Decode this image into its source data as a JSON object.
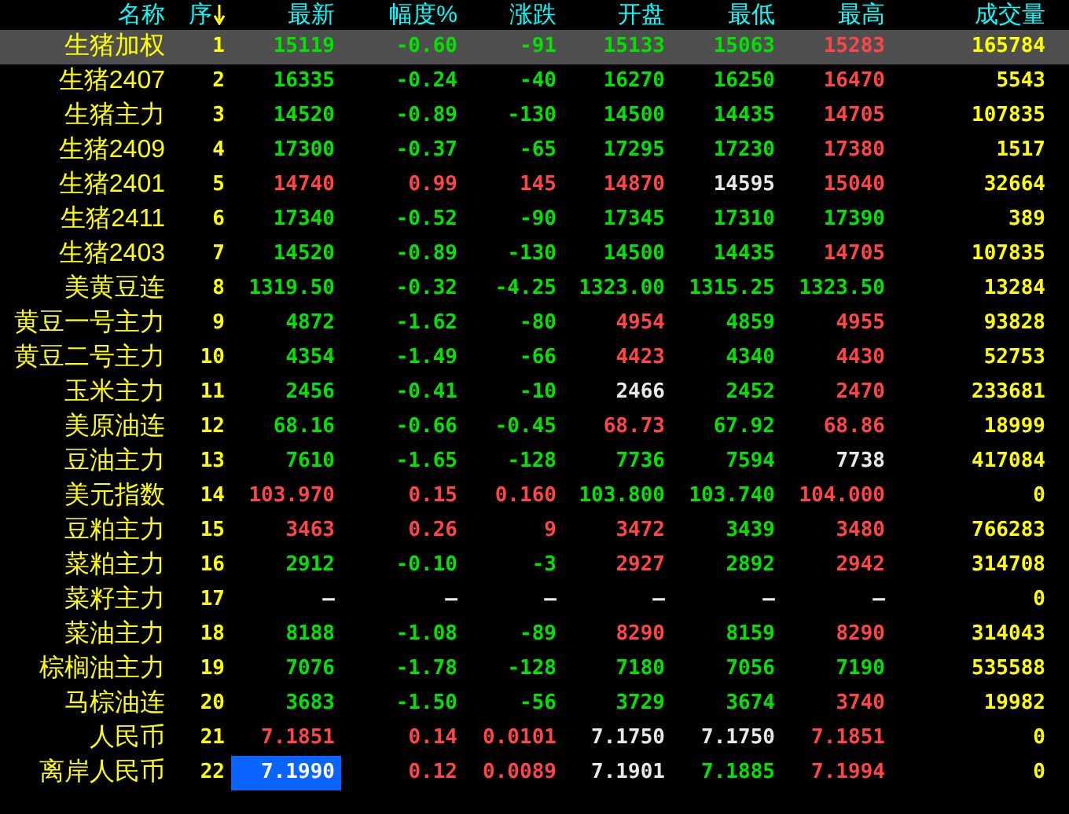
{
  "table": {
    "columns": [
      {
        "label": "名称",
        "sorted": false
      },
      {
        "label": "序",
        "sorted": true
      },
      {
        "label": "最新",
        "sorted": false
      },
      {
        "label": "幅度%",
        "sorted": false
      },
      {
        "label": "涨跌",
        "sorted": false
      },
      {
        "label": "开盘",
        "sorted": false
      },
      {
        "label": "最低",
        "sorted": false
      },
      {
        "label": "最高",
        "sorted": false
      },
      {
        "label": "成交量",
        "sorted": false
      }
    ],
    "rows": [
      {
        "selected": true,
        "focused": false,
        "cells": [
          {
            "text": "生猪加权",
            "color": "#ffff00"
          },
          {
            "text": "1",
            "color": "#ffff00"
          },
          {
            "text": "15119",
            "color": "#00e400"
          },
          {
            "text": "-0.60",
            "color": "#00e400"
          },
          {
            "text": "-91",
            "color": "#00e400"
          },
          {
            "text": "15133",
            "color": "#00e400"
          },
          {
            "text": "15063",
            "color": "#00e400"
          },
          {
            "text": "15283",
            "color": "#ff4545"
          },
          {
            "text": "165784",
            "color": "#ffff00"
          }
        ]
      },
      {
        "selected": false,
        "focused": false,
        "cells": [
          {
            "text": "生猪2407",
            "color": "#ffff00"
          },
          {
            "text": "2",
            "color": "#ffff00"
          },
          {
            "text": "16335",
            "color": "#00e400"
          },
          {
            "text": "-0.24",
            "color": "#00e400"
          },
          {
            "text": "-40",
            "color": "#00e400"
          },
          {
            "text": "16270",
            "color": "#00e400"
          },
          {
            "text": "16250",
            "color": "#00e400"
          },
          {
            "text": "16470",
            "color": "#ff4545"
          },
          {
            "text": "5543",
            "color": "#ffff00"
          }
        ]
      },
      {
        "selected": false,
        "focused": false,
        "cells": [
          {
            "text": "生猪主力",
            "color": "#ffff00"
          },
          {
            "text": "3",
            "color": "#ffff00"
          },
          {
            "text": "14520",
            "color": "#00e400"
          },
          {
            "text": "-0.89",
            "color": "#00e400"
          },
          {
            "text": "-130",
            "color": "#00e400"
          },
          {
            "text": "14500",
            "color": "#00e400"
          },
          {
            "text": "14435",
            "color": "#00e400"
          },
          {
            "text": "14705",
            "color": "#ff4545"
          },
          {
            "text": "107835",
            "color": "#ffff00"
          }
        ]
      },
      {
        "selected": false,
        "focused": false,
        "cells": [
          {
            "text": "生猪2409",
            "color": "#ffff00"
          },
          {
            "text": "4",
            "color": "#ffff00"
          },
          {
            "text": "17300",
            "color": "#00e400"
          },
          {
            "text": "-0.37",
            "color": "#00e400"
          },
          {
            "text": "-65",
            "color": "#00e400"
          },
          {
            "text": "17295",
            "color": "#00e400"
          },
          {
            "text": "17230",
            "color": "#00e400"
          },
          {
            "text": "17380",
            "color": "#ff4545"
          },
          {
            "text": "1517",
            "color": "#ffff00"
          }
        ]
      },
      {
        "selected": false,
        "focused": false,
        "cells": [
          {
            "text": "生猪2401",
            "color": "#ffff00"
          },
          {
            "text": "5",
            "color": "#ffff00"
          },
          {
            "text": "14740",
            "color": "#ff4545"
          },
          {
            "text": "0.99",
            "color": "#ff4545"
          },
          {
            "text": "145",
            "color": "#ff4545"
          },
          {
            "text": "14870",
            "color": "#ff4545"
          },
          {
            "text": "14595",
            "color": "#e8e8e8"
          },
          {
            "text": "15040",
            "color": "#ff4545"
          },
          {
            "text": "32664",
            "color": "#ffff00"
          }
        ]
      },
      {
        "selected": false,
        "focused": false,
        "cells": [
          {
            "text": "生猪2411",
            "color": "#ffff00"
          },
          {
            "text": "6",
            "color": "#ffff00"
          },
          {
            "text": "17340",
            "color": "#00e400"
          },
          {
            "text": "-0.52",
            "color": "#00e400"
          },
          {
            "text": "-90",
            "color": "#00e400"
          },
          {
            "text": "17345",
            "color": "#00e400"
          },
          {
            "text": "17310",
            "color": "#00e400"
          },
          {
            "text": "17390",
            "color": "#00e400"
          },
          {
            "text": "389",
            "color": "#ffff00"
          }
        ]
      },
      {
        "selected": false,
        "focused": false,
        "cells": [
          {
            "text": "生猪2403",
            "color": "#ffff00"
          },
          {
            "text": "7",
            "color": "#ffff00"
          },
          {
            "text": "14520",
            "color": "#00e400"
          },
          {
            "text": "-0.89",
            "color": "#00e400"
          },
          {
            "text": "-130",
            "color": "#00e400"
          },
          {
            "text": "14500",
            "color": "#00e400"
          },
          {
            "text": "14435",
            "color": "#00e400"
          },
          {
            "text": "14705",
            "color": "#ff4545"
          },
          {
            "text": "107835",
            "color": "#ffff00"
          }
        ]
      },
      {
        "selected": false,
        "focused": false,
        "cells": [
          {
            "text": "美黄豆连",
            "color": "#ffff00"
          },
          {
            "text": "8",
            "color": "#ffff00"
          },
          {
            "text": "1319.50",
            "color": "#00e400"
          },
          {
            "text": "-0.32",
            "color": "#00e400"
          },
          {
            "text": "-4.25",
            "color": "#00e400"
          },
          {
            "text": "1323.00",
            "color": "#00e400"
          },
          {
            "text": "1315.25",
            "color": "#00e400"
          },
          {
            "text": "1323.50",
            "color": "#00e400"
          },
          {
            "text": "13284",
            "color": "#ffff00"
          }
        ]
      },
      {
        "selected": false,
        "focused": false,
        "cells": [
          {
            "text": "黄豆一号主力",
            "color": "#ffff00"
          },
          {
            "text": "9",
            "color": "#ffff00"
          },
          {
            "text": "4872",
            "color": "#00e400"
          },
          {
            "text": "-1.62",
            "color": "#00e400"
          },
          {
            "text": "-80",
            "color": "#00e400"
          },
          {
            "text": "4954",
            "color": "#ff4545"
          },
          {
            "text": "4859",
            "color": "#00e400"
          },
          {
            "text": "4955",
            "color": "#ff4545"
          },
          {
            "text": "93828",
            "color": "#ffff00"
          }
        ]
      },
      {
        "selected": false,
        "focused": false,
        "cells": [
          {
            "text": "黄豆二号主力",
            "color": "#ffff00"
          },
          {
            "text": "10",
            "color": "#ffff00"
          },
          {
            "text": "4354",
            "color": "#00e400"
          },
          {
            "text": "-1.49",
            "color": "#00e400"
          },
          {
            "text": "-66",
            "color": "#00e400"
          },
          {
            "text": "4423",
            "color": "#ff4545"
          },
          {
            "text": "4340",
            "color": "#00e400"
          },
          {
            "text": "4430",
            "color": "#ff4545"
          },
          {
            "text": "52753",
            "color": "#ffff00"
          }
        ]
      },
      {
        "selected": false,
        "focused": false,
        "cells": [
          {
            "text": "玉米主力",
            "color": "#ffff00"
          },
          {
            "text": "11",
            "color": "#ffff00"
          },
          {
            "text": "2456",
            "color": "#00e400"
          },
          {
            "text": "-0.41",
            "color": "#00e400"
          },
          {
            "text": "-10",
            "color": "#00e400"
          },
          {
            "text": "2466",
            "color": "#e8e8e8"
          },
          {
            "text": "2452",
            "color": "#00e400"
          },
          {
            "text": "2470",
            "color": "#ff4545"
          },
          {
            "text": "233681",
            "color": "#ffff00"
          }
        ]
      },
      {
        "selected": false,
        "focused": false,
        "cells": [
          {
            "text": "美原油连",
            "color": "#ffff00"
          },
          {
            "text": "12",
            "color": "#ffff00"
          },
          {
            "text": "68.16",
            "color": "#00e400"
          },
          {
            "text": "-0.66",
            "color": "#00e400"
          },
          {
            "text": "-0.45",
            "color": "#00e400"
          },
          {
            "text": "68.73",
            "color": "#ff4545"
          },
          {
            "text": "67.92",
            "color": "#00e400"
          },
          {
            "text": "68.86",
            "color": "#ff4545"
          },
          {
            "text": "18999",
            "color": "#ffff00"
          }
        ]
      },
      {
        "selected": false,
        "focused": false,
        "cells": [
          {
            "text": "豆油主力",
            "color": "#ffff00"
          },
          {
            "text": "13",
            "color": "#ffff00"
          },
          {
            "text": "7610",
            "color": "#00e400"
          },
          {
            "text": "-1.65",
            "color": "#00e400"
          },
          {
            "text": "-128",
            "color": "#00e400"
          },
          {
            "text": "7736",
            "color": "#00e400"
          },
          {
            "text": "7594",
            "color": "#00e400"
          },
          {
            "text": "7738",
            "color": "#e8e8e8"
          },
          {
            "text": "417084",
            "color": "#ffff00"
          }
        ]
      },
      {
        "selected": false,
        "focused": false,
        "cells": [
          {
            "text": "美元指数",
            "color": "#ffff00"
          },
          {
            "text": "14",
            "color": "#ffff00"
          },
          {
            "text": "103.970",
            "color": "#ff4545"
          },
          {
            "text": "0.15",
            "color": "#ff4545"
          },
          {
            "text": "0.160",
            "color": "#ff4545"
          },
          {
            "text": "103.800",
            "color": "#00e400"
          },
          {
            "text": "103.740",
            "color": "#00e400"
          },
          {
            "text": "104.000",
            "color": "#ff4545"
          },
          {
            "text": "0",
            "color": "#ffff00"
          }
        ]
      },
      {
        "selected": false,
        "focused": false,
        "cells": [
          {
            "text": "豆粕主力",
            "color": "#ffff00"
          },
          {
            "text": "15",
            "color": "#ffff00"
          },
          {
            "text": "3463",
            "color": "#ff4545"
          },
          {
            "text": "0.26",
            "color": "#ff4545"
          },
          {
            "text": "9",
            "color": "#ff4545"
          },
          {
            "text": "3472",
            "color": "#ff4545"
          },
          {
            "text": "3439",
            "color": "#00e400"
          },
          {
            "text": "3480",
            "color": "#ff4545"
          },
          {
            "text": "766283",
            "color": "#ffff00"
          }
        ]
      },
      {
        "selected": false,
        "focused": false,
        "cells": [
          {
            "text": "菜粕主力",
            "color": "#ffff00"
          },
          {
            "text": "16",
            "color": "#ffff00"
          },
          {
            "text": "2912",
            "color": "#00e400"
          },
          {
            "text": "-0.10",
            "color": "#00e400"
          },
          {
            "text": "-3",
            "color": "#00e400"
          },
          {
            "text": "2927",
            "color": "#ff4545"
          },
          {
            "text": "2892",
            "color": "#00e400"
          },
          {
            "text": "2942",
            "color": "#ff4545"
          },
          {
            "text": "314708",
            "color": "#ffff00"
          }
        ]
      },
      {
        "selected": false,
        "focused": false,
        "cells": [
          {
            "text": "菜籽主力",
            "color": "#ffff00"
          },
          {
            "text": "17",
            "color": "#ffff00"
          },
          {
            "text": "—",
            "color": "#e8e8e8"
          },
          {
            "text": "—",
            "color": "#e8e8e8"
          },
          {
            "text": "—",
            "color": "#e8e8e8"
          },
          {
            "text": "—",
            "color": "#e8e8e8"
          },
          {
            "text": "—",
            "color": "#e8e8e8"
          },
          {
            "text": "—",
            "color": "#e8e8e8"
          },
          {
            "text": "0",
            "color": "#ffff00"
          }
        ]
      },
      {
        "selected": false,
        "focused": false,
        "cells": [
          {
            "text": "菜油主力",
            "color": "#ffff00"
          },
          {
            "text": "18",
            "color": "#ffff00"
          },
          {
            "text": "8188",
            "color": "#00e400"
          },
          {
            "text": "-1.08",
            "color": "#00e400"
          },
          {
            "text": "-89",
            "color": "#00e400"
          },
          {
            "text": "8290",
            "color": "#ff4545"
          },
          {
            "text": "8159",
            "color": "#00e400"
          },
          {
            "text": "8290",
            "color": "#ff4545"
          },
          {
            "text": "314043",
            "color": "#ffff00"
          }
        ]
      },
      {
        "selected": false,
        "focused": false,
        "cells": [
          {
            "text": "棕榈油主力",
            "color": "#ffff00"
          },
          {
            "text": "19",
            "color": "#ffff00"
          },
          {
            "text": "7076",
            "color": "#00e400"
          },
          {
            "text": "-1.78",
            "color": "#00e400"
          },
          {
            "text": "-128",
            "color": "#00e400"
          },
          {
            "text": "7180",
            "color": "#00e400"
          },
          {
            "text": "7056",
            "color": "#00e400"
          },
          {
            "text": "7190",
            "color": "#00e400"
          },
          {
            "text": "535588",
            "color": "#ffff00"
          }
        ]
      },
      {
        "selected": false,
        "focused": false,
        "cells": [
          {
            "text": "马棕油连",
            "color": "#ffff00"
          },
          {
            "text": "20",
            "color": "#ffff00"
          },
          {
            "text": "3683",
            "color": "#00e400"
          },
          {
            "text": "-1.50",
            "color": "#00e400"
          },
          {
            "text": "-56",
            "color": "#00e400"
          },
          {
            "text": "3729",
            "color": "#00e400"
          },
          {
            "text": "3674",
            "color": "#00e400"
          },
          {
            "text": "3740",
            "color": "#ff4545"
          },
          {
            "text": "19982",
            "color": "#ffff00"
          }
        ]
      },
      {
        "selected": false,
        "focused": false,
        "cells": [
          {
            "text": "人民币",
            "color": "#ffff00"
          },
          {
            "text": "21",
            "color": "#ffff00"
          },
          {
            "text": "7.1851",
            "color": "#ff4545"
          },
          {
            "text": "0.14",
            "color": "#ff4545"
          },
          {
            "text": "0.0101",
            "color": "#ff4545"
          },
          {
            "text": "7.1750",
            "color": "#e8e8e8"
          },
          {
            "text": "7.1750",
            "color": "#e8e8e8"
          },
          {
            "text": "7.1851",
            "color": "#ff4545"
          },
          {
            "text": "0",
            "color": "#ffff00"
          }
        ]
      },
      {
        "selected": false,
        "focused": true,
        "cells": [
          {
            "text": "离岸人民币",
            "color": "#ffff00"
          },
          {
            "text": "22",
            "color": "#ffff00"
          },
          {
            "text": "7.1990",
            "color": "#ffffff"
          },
          {
            "text": "0.12",
            "color": "#ff4545"
          },
          {
            "text": "0.0089",
            "color": "#ff4545"
          },
          {
            "text": "7.1901",
            "color": "#e8e8e8"
          },
          {
            "text": "7.1885",
            "color": "#00e400"
          },
          {
            "text": "7.1994",
            "color": "#ff4545"
          },
          {
            "text": "0",
            "color": "#ffff00"
          }
        ]
      }
    ]
  }
}
